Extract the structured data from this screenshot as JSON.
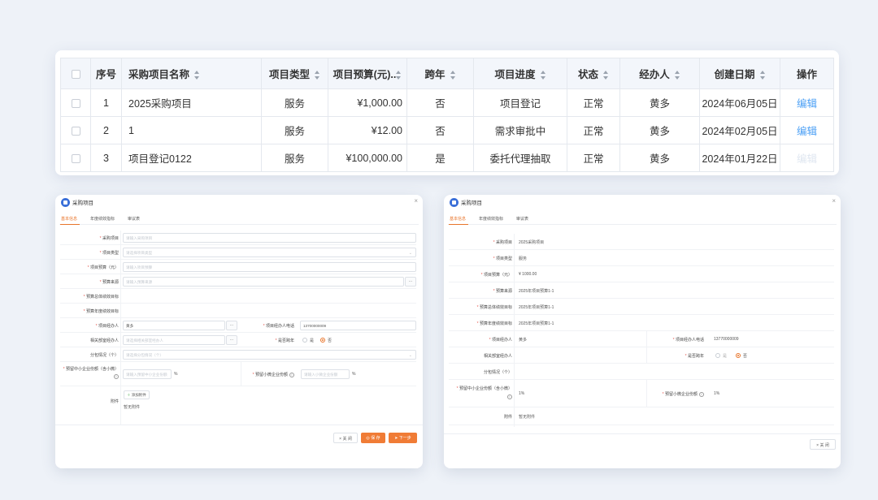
{
  "table": {
    "headers": {
      "index": "序号",
      "name": "采购项目名称",
      "type": "项目类型",
      "budget": "项目预算(元)..",
      "cross_year": "跨年",
      "progress": "项目进度",
      "status": "状态",
      "handler": "经办人",
      "created": "创建日期",
      "action": "操作"
    },
    "rows": [
      {
        "index": "1",
        "name": "2025采购项目",
        "type": "服务",
        "budget": "¥1,000.00",
        "cross_year": "否",
        "progress": "项目登记",
        "status": "正常",
        "handler": "黄多",
        "created": "2024年06月05日",
        "action": "编辑"
      },
      {
        "index": "2",
        "name": "1",
        "type": "服务",
        "budget": "¥12.00",
        "cross_year": "否",
        "progress": "需求审批中",
        "status": "正常",
        "handler": "黄多",
        "created": "2024年02月05日",
        "action": "编辑"
      },
      {
        "index": "3",
        "name": "项目登记0122",
        "type": "服务",
        "budget": "¥100,000.00",
        "cross_year": "是",
        "progress": "委托代理抽取",
        "status": "正常",
        "handler": "黄多",
        "created": "2024年01月22日",
        "action": "编辑"
      }
    ]
  },
  "dialog_edit": {
    "title": "采购项目",
    "close": "×",
    "tabs": [
      "基本信息",
      "年度绩效指标",
      "审议表"
    ],
    "labels": {
      "project": "采购项目",
      "type": "项目类型",
      "budget": "项目预算（元）",
      "source": "预算来源",
      "perf_total": "预算总体绩效目标",
      "perf_year": "预算年度绩效目标",
      "handler": "项目经办人",
      "phone": "项目经办人电话",
      "dept_handler": "相关部室经办人",
      "cross_year": "是否跨年",
      "split": "分包情况（个）",
      "sme_share": "预留中小企业份额（含小微）",
      "micro_share": "预留小微企业份额",
      "attachment": "附件"
    },
    "placeholders": {
      "project": "请输入采购项目",
      "type": "请选择项目类型",
      "budget": "请输入项目预算",
      "source": "请输入预算来源",
      "dept_handler": "请选择相关部室经办人",
      "split": "请选择分包情况（个）",
      "sme_share": "请输入预留中小企业份额",
      "micro_share": "请输入小微企业份额"
    },
    "values": {
      "handler": "黄多",
      "phone": "13700000009",
      "dots": "···",
      "percent": "%",
      "radio_no": "是",
      "radio_yes": "否",
      "add_attachment": "添加附件",
      "no_attachment": "暂无附件"
    },
    "buttons": {
      "close": "× 关 闭",
      "save": "保 存",
      "next": "下一步"
    }
  },
  "dialog_view": {
    "title": "采购项目",
    "close": "×",
    "tabs": [
      "基本信息",
      "年度绩效指标",
      "审议表"
    ],
    "values": {
      "project": "2025采购项目",
      "type": "服务",
      "budget": "¥ 1000.00",
      "source": "2025年项目预算1-1",
      "perf_total": "2025年项目预算1-1",
      "perf_year": "2025年项目预算1-1",
      "handler": "黄多",
      "phone": "13770000009",
      "radio_no": "是",
      "radio_yes": "否",
      "sme_share": "1%",
      "micro_share": "1%",
      "attachment": "暂无附件"
    },
    "buttons": {
      "close": "× 关 闭"
    }
  }
}
